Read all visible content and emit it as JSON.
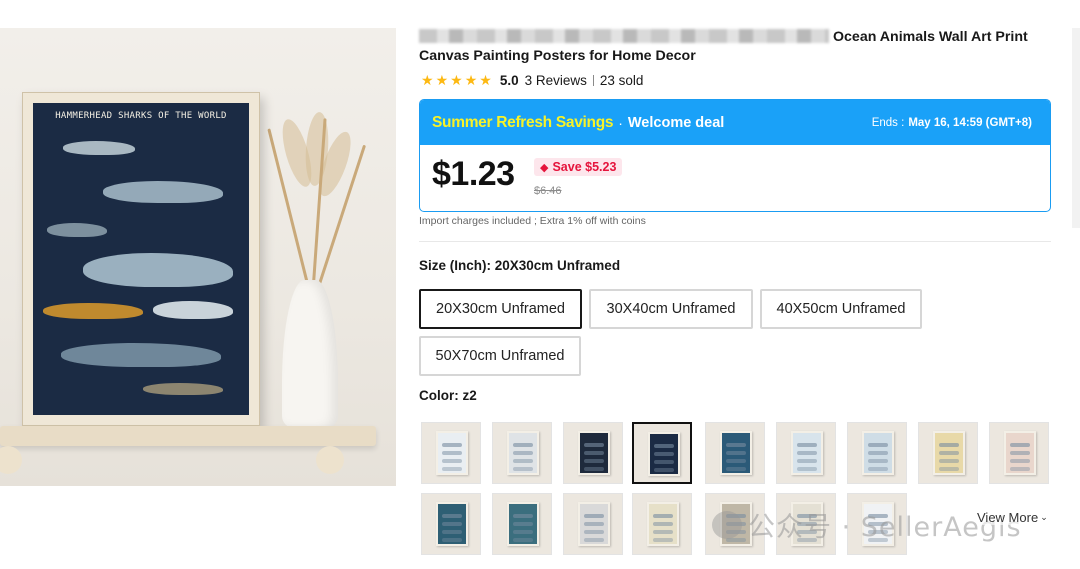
{
  "product": {
    "title_visible": "Ocean Animals Wall Art Print Canvas Painting Posters for Home Decor",
    "poster_title": "HAMMERHEAD SHARKS OF THE WORLD"
  },
  "rating": {
    "stars": 5,
    "value": "5.0",
    "reviews": "3 Reviews",
    "sold": "23 sold"
  },
  "deal": {
    "name": "Summer Refresh Savings",
    "separator": "·",
    "subtitle": "Welcome deal",
    "ends_label": "Ends :",
    "ends_date": "May 16, 14:59 (GMT+8)",
    "price": "$1.23",
    "save": "Save $5.23",
    "old_price": "$6.46"
  },
  "import_note": "Import charges included ; Extra 1% off with coins",
  "size": {
    "label": "Size (Inch): 20X30cm Unframed",
    "options": [
      "20X30cm Unframed",
      "30X40cm Unframed",
      "40X50cm Unframed",
      "50X70cm Unframed"
    ],
    "selected": "20X30cm Unframed"
  },
  "color": {
    "label": "Color: z2",
    "selected": "z2",
    "swatch_count_visible": 16,
    "view_more": "View More",
    "swatch_colors": [
      "#e9eef2",
      "#dfe3e6",
      "#1e2a3c",
      "#1b2b44",
      "#2b5a78",
      "#d8e4ec",
      "#cfdde6",
      "#e8d9a8",
      "#e9d6cc",
      "#2e5f74",
      "#3b6e7e",
      "#d9d9d9",
      "#e6e0c8",
      "#bfb7a6",
      "#e4e0d4",
      "#f0f2f4"
    ]
  },
  "watermark": "公众号 · SellerAegis",
  "colors": {
    "deal_blue": "#1aa1f8",
    "deal_yellow": "#f8f228",
    "save_red": "#e5143c",
    "star": "#fdb913"
  }
}
